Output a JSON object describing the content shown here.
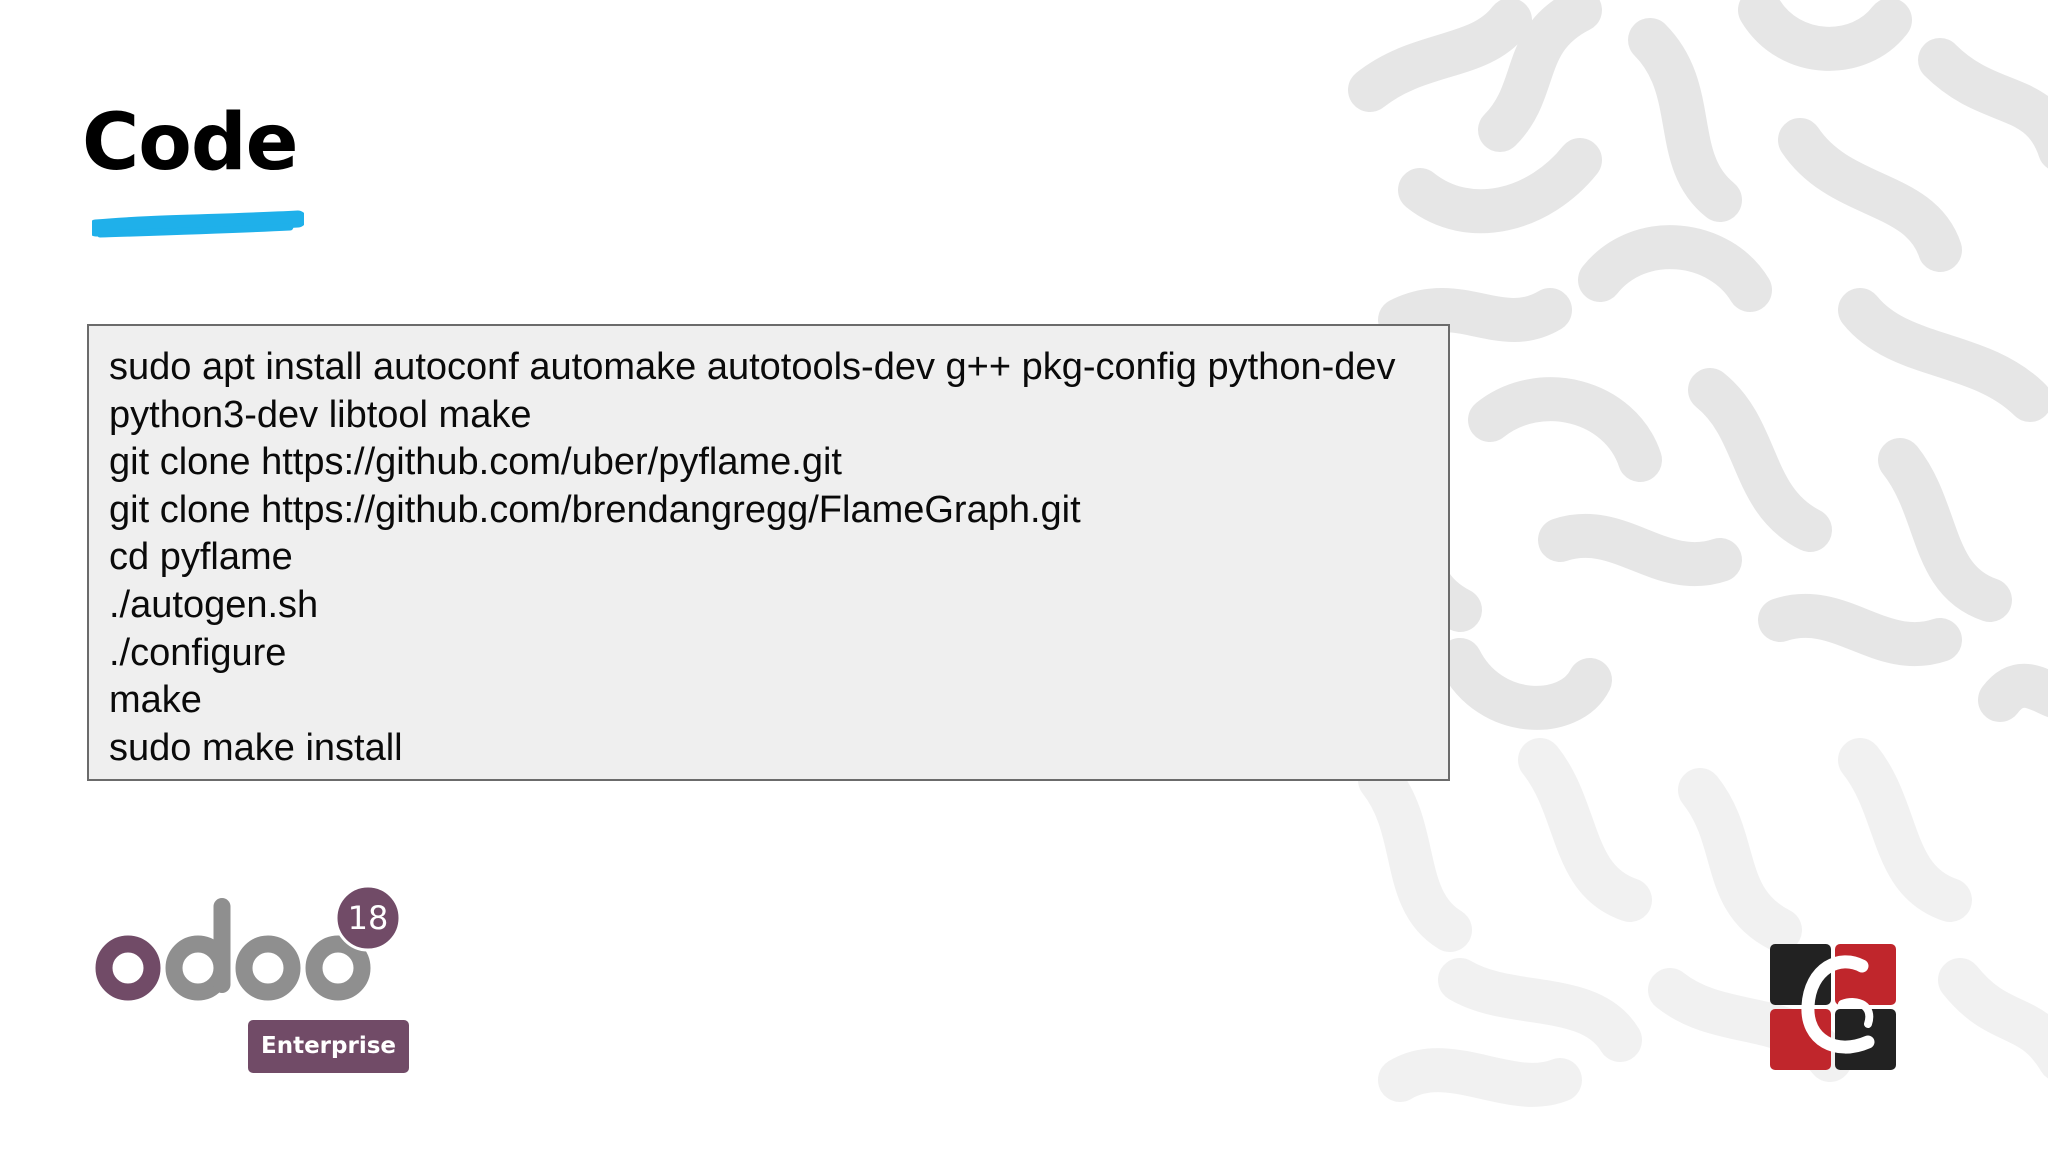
{
  "slide": {
    "title": "Code"
  },
  "code_block": {
    "lines": [
      "sudo apt install autoconf automake autotools-dev g++ pkg-config python-dev python3-dev libtool make",
      "git clone https://github.com/uber/pyflame.git",
      "git clone https://github.com/brendangregg/FlameGraph.git",
      "cd pyflame",
      "./autogen.sh",
      "./configure",
      "make",
      "sudo make install"
    ]
  },
  "odoo_logo": {
    "wordmark": "odoo",
    "version": "18",
    "edition": "Enterprise"
  },
  "colors": {
    "underline_accent": "#1fb0ea",
    "odoo_purple": "#714b67",
    "odoo_grey": "#8f8f8f",
    "code_background": "#efefef",
    "brand_red": "#c0262c",
    "brand_black": "#222222"
  },
  "icons": {
    "brand": "cg-monogram-logo",
    "background": "squiggle-pattern"
  }
}
